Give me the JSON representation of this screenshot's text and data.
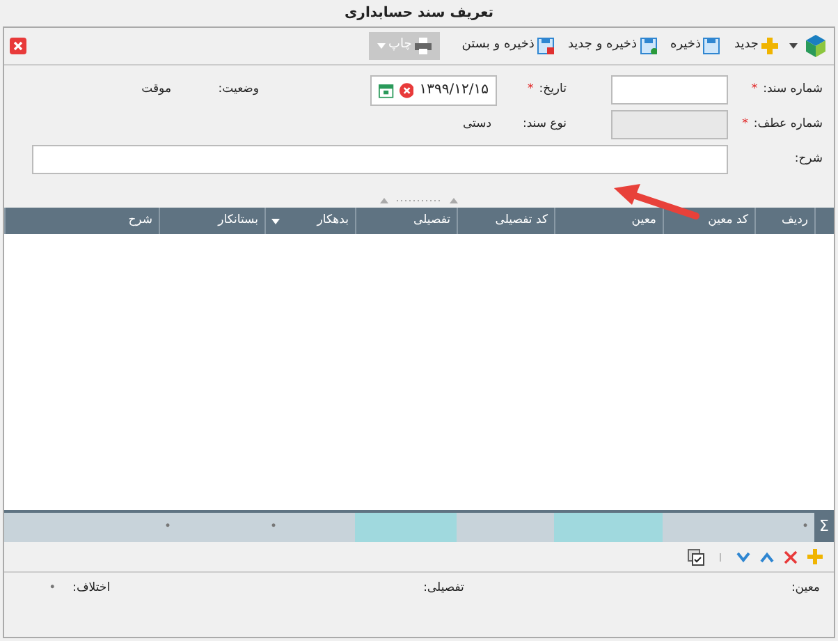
{
  "window": {
    "title": "تعریف سند حسابداری"
  },
  "toolbar": {
    "buttons": [
      {
        "label": "جدید",
        "kind": "new",
        "disabled": false
      },
      {
        "label": "ذخیره",
        "kind": "save",
        "disabled": false
      },
      {
        "label": "ذخیره و جدید",
        "kind": "save-new",
        "disabled": false
      },
      {
        "label": "ذخیره و بستن",
        "kind": "save-close",
        "disabled": false
      },
      {
        "label": "چاپ",
        "kind": "print",
        "disabled": true
      }
    ]
  },
  "form": {
    "row_1": [
      {
        "label": "شماره سند:",
        "marker": "*",
        "kind": "input",
        "disabled": false
      },
      {
        "label": "تاریخ:",
        "marker": "*",
        "kind": "date",
        "value": "۱۳۹۹/۱۲/۱۵"
      },
      {
        "label": "وضعیت:",
        "kind": "text",
        "value": "موقت"
      }
    ],
    "row_2": [
      {
        "label": "شماره عطف:",
        "marker": "*",
        "kind": "input",
        "disabled": true
      },
      {
        "label": "نوع سند:",
        "kind": "text",
        "value": "دستی"
      }
    ],
    "description": {
      "label": "شرح:"
    }
  },
  "grid": {
    "columns": [
      {
        "label": "ردیف",
        "dropdown": false
      },
      {
        "label": "کد معین",
        "dropdown": false
      },
      {
        "label": "معین",
        "dropdown": false
      },
      {
        "label": "کد تفصیلی",
        "dropdown": false
      },
      {
        "label": "تفصیلی",
        "dropdown": false
      },
      {
        "label": "بدهکار",
        "dropdown": true
      },
      {
        "label": "بستانکار",
        "dropdown": false
      },
      {
        "label": "شرح",
        "dropdown": false
      }
    ],
    "summary": {
      "symbol": "Σ",
      "cells": [
        {
          "kind": "count",
          "highlighted": false,
          "text": "•"
        },
        {
          "kind": "count",
          "highlighted": true
        },
        {
          "kind": "count",
          "highlighted": false
        },
        {
          "kind": "count",
          "highlighted": true
        },
        {
          "kind": "amount",
          "highlighted": false,
          "text": "•"
        },
        {
          "kind": "amount",
          "highlighted": false,
          "text": "•"
        },
        {
          "kind": "amount",
          "highlighted": false
        }
      ]
    }
  },
  "totals": [
    {
      "label": "معین:"
    },
    {
      "label": "تفصیلی:"
    },
    {
      "label": "اختلاف:",
      "value": "•"
    }
  ]
}
